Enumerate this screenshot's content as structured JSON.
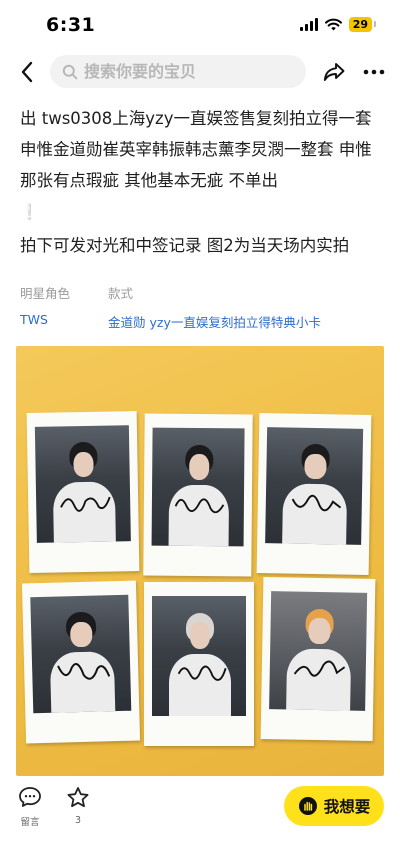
{
  "status_bar": {
    "time": "6:31",
    "battery": "29"
  },
  "nav": {
    "search_placeholder": "搜索你要的宝贝"
  },
  "description": {
    "paragraph_1": "出 tws0308上海yzy一直娱签售复刻拍立得一套 申惟金道勋崔英宰韩振韩志薰李炅潣一整套 申惟那张有点瑕疵 其他基本无疵 不单出",
    "warn_mark": "❕",
    "paragraph_2": "拍下可发对光和中签记录 图2为当天场内实拍"
  },
  "attributes": [
    {
      "label": "明星角色",
      "value": "TWS"
    },
    {
      "label": "款式",
      "value": "金道勋 yzy一直娱复刻拍立得特典小卡"
    }
  ],
  "bottom_bar": {
    "comment_label": "留言",
    "favorite_count": "3",
    "want_label": "我想要"
  },
  "colors": {
    "accent_yellow": "#ffe11b",
    "link_blue": "#2a6dd3",
    "photo_background": "#f0c14b"
  },
  "icons": {
    "back": "chevron-left-icon",
    "search": "magnifier-icon",
    "share": "share-arrow-icon",
    "more": "more-dots-icon",
    "comment": "chat-bubble-icon",
    "favorite": "star-icon",
    "want": "hand-icon"
  }
}
